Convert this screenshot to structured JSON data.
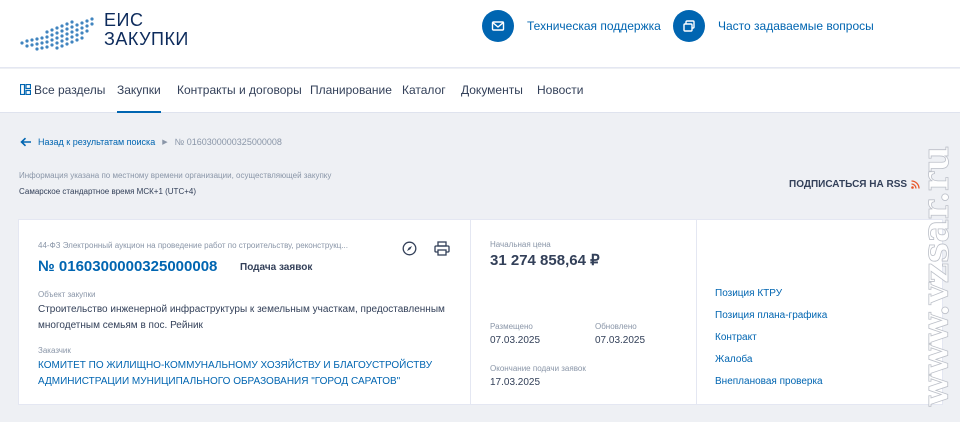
{
  "header": {
    "logo_line1": "ЕИС",
    "logo_line2": "ЗАКУПКИ",
    "support_label": "Техническая поддержка",
    "support_icon": "mail-icon",
    "faq_label": "Часто задаваемые вопросы",
    "faq_icon": "faq-icon"
  },
  "nav": {
    "items": [
      "Все разделы",
      "Закупки",
      "Контракты и договоры",
      "Планирование",
      "Каталог",
      "Документы",
      "Новости"
    ],
    "active": "Закупки"
  },
  "breadcrumb": {
    "back_label": "Назад к результатам поиска",
    "current": "№ 0160300000325000008"
  },
  "timezone": {
    "note": "Информация указана по местному времени организации, осуществляющей закупку",
    "zone": "Самарское стандартное время МСК+1 (UTC+4)"
  },
  "rss_label": "ПОДПИСАТЬСЯ НА RSS",
  "card": {
    "procurement_type": "44-ФЗ Электронный аукцион на проведение работ по строительству, реконструкц...",
    "number": "№ 0160300000325000008",
    "status": "Подача заявок",
    "object_label": "Объект закупки",
    "object_value": "Строительство инженерной инфраструктуры к земельным участкам, предоставленным многодетным семьям в пос. Рейник",
    "customer_label": "Заказчик",
    "customer_value": "КОМИТЕТ ПО ЖИЛИЩНО-КОММУНАЛЬНОМУ ХОЗЯЙСТВУ И БЛАГОУСТРОЙСТВУ АДМИНИСТРАЦИИ МУНИЦИПАЛЬНОГО ОБРАЗОВАНИЯ \"ГОРОД САРАТОВ\"",
    "price_label": "Начальная цена",
    "price_value": "31 274 858,64 ₽",
    "published_label": "Размещено",
    "published_value": "07.03.2025",
    "updated_label": "Обновлено",
    "updated_value": "07.03.2025",
    "deadline_label": "Окончание подачи заявок",
    "deadline_value": "17.03.2025",
    "links": [
      "Позиция КТРУ",
      "Позиция плана-графика",
      "Контракт",
      "Жалоба",
      "Внеплановая проверка"
    ]
  },
  "watermark": "www.vzsar.ru",
  "colors": {
    "accent": "#0065b1",
    "text": "#334059",
    "muted": "#8a96a8",
    "background": "#eef0f4",
    "rss": "#e8562a"
  }
}
